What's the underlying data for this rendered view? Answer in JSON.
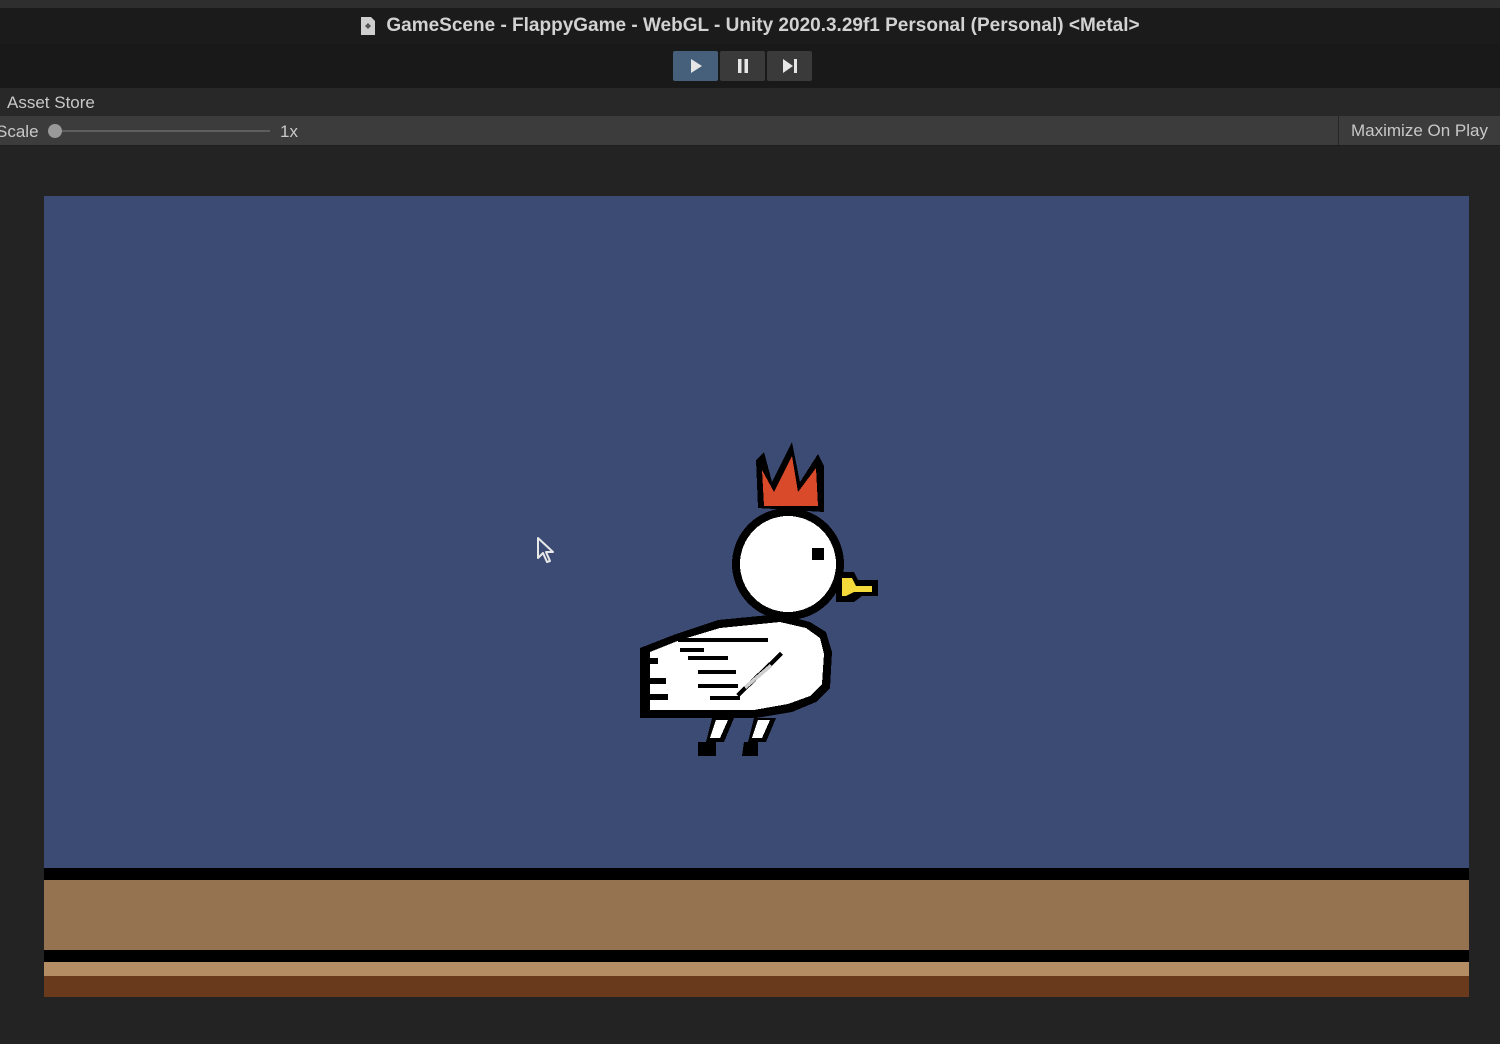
{
  "window": {
    "title": "GameScene - FlappyGame - WebGL - Unity 2020.3.29f1 Personal (Personal) <Metal>"
  },
  "playbar": {
    "play_icon": "play-icon",
    "pause_icon": "pause-icon",
    "step_icon": "step-icon",
    "play_active": true
  },
  "tab": {
    "label": "Asset Store"
  },
  "toolbar": {
    "scale_label": "Scale",
    "scale_value": "1x",
    "maximize_label": "Maximize On Play"
  },
  "game": {
    "sky_color": "#3b4b73",
    "ground_color": "#957250",
    "bird_crown_color": "#d94a2b",
    "bird_beak_color": "#f3da3a"
  }
}
